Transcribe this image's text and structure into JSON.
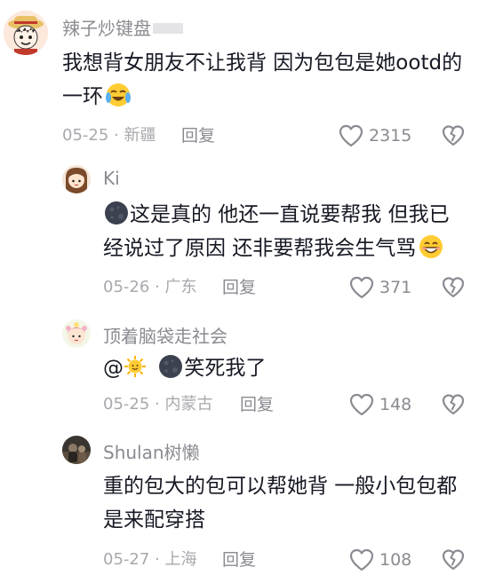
{
  "comments": [
    {
      "author": "辣子炒键盘",
      "line1": "我想背女朋友不让我背 因为包包是她ootd的",
      "line2": "一环",
      "line2_emoji": "crying-laughing-emoji",
      "date": "05-25",
      "location": "新疆",
      "reply_label": "回复",
      "likes": "2315"
    },
    {
      "author": "Ki",
      "emoji_prefix": "dark-moon-emoji",
      "line1": "这是真的 他还一直说要帮我 但我已",
      "line2": "经说过了原因 还非要帮我会生气骂",
      "line2_emoji": "grinning-face-emoji",
      "date": "05-26",
      "location": "广东",
      "reply_label": "回复",
      "likes": "371"
    },
    {
      "author": "顶着脑袋走社会",
      "at": "@",
      "text": "笑死我了",
      "emojis": [
        "sun-face-emoji",
        "dark-moon-emoji"
      ],
      "date": "05-25",
      "location": "内蒙古",
      "reply_label": "回复",
      "likes": "148"
    },
    {
      "author": "Shulan树懒",
      "line1": "重的包大的包可以帮她背 一般小包包都",
      "line2": "是来配穿搭",
      "date": "05-27",
      "location": "上海",
      "reply_label": "回复",
      "likes": "108"
    }
  ],
  "meta_separator": "·",
  "colors": {
    "text": "#161823",
    "secondary": "#8a8b91",
    "meta": "#a8a9ad",
    "background": "#ffffff"
  }
}
